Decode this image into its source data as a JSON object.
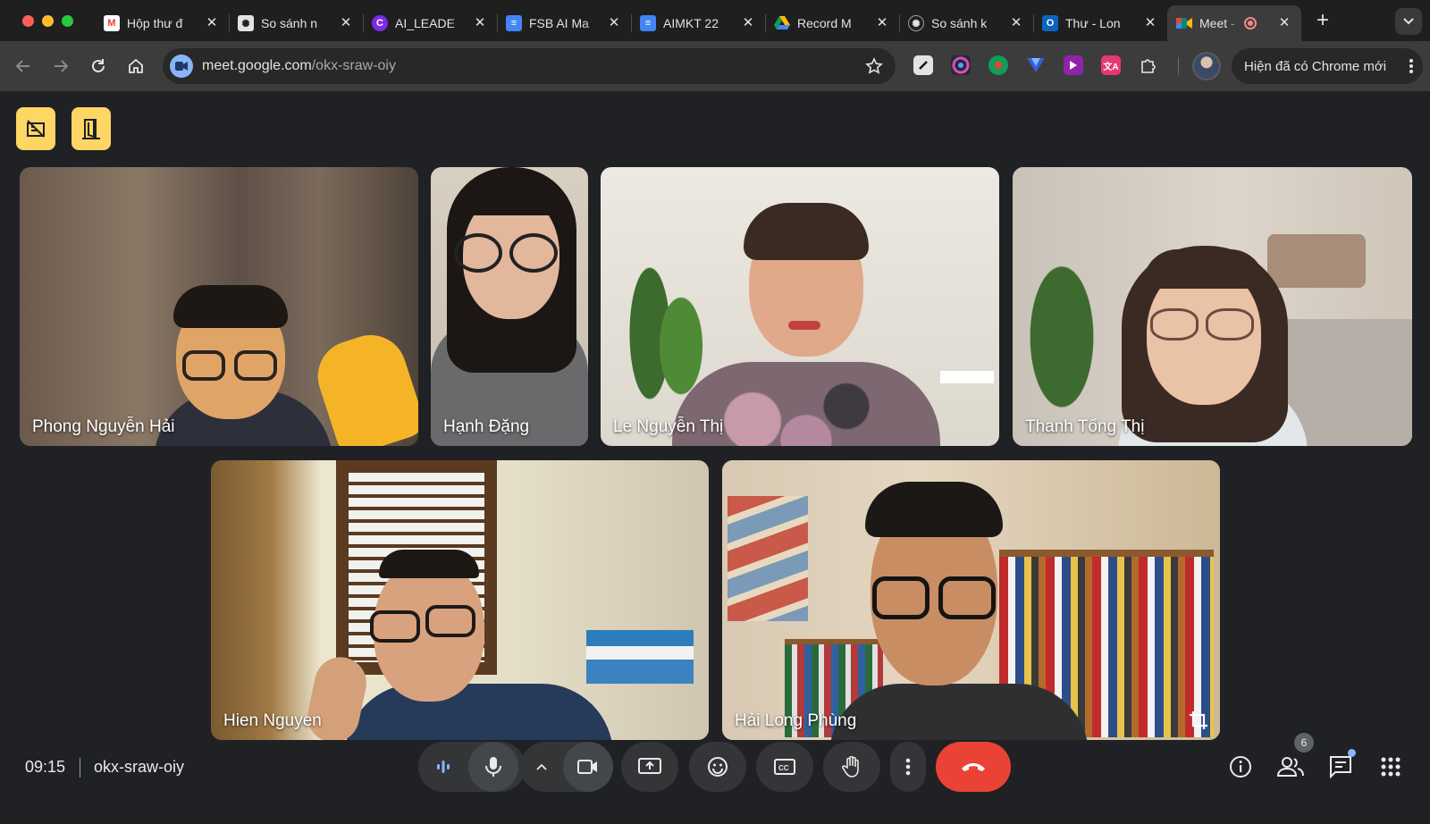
{
  "browser": {
    "tabs": [
      {
        "title": "Hộp thư đ",
        "favicon": "gmail-icon",
        "color": "#ea4335"
      },
      {
        "title": "So sánh n",
        "favicon": "chatgpt-icon",
        "color": "#9e9e9e"
      },
      {
        "title": "AI_LEADE",
        "favicon": "canva-icon",
        "color": "#7d2ae8"
      },
      {
        "title": "FSB AI Ma",
        "favicon": "docs-icon",
        "color": "#4285f4"
      },
      {
        "title": "AIMKT 22",
        "favicon": "docs-icon",
        "color": "#4285f4"
      },
      {
        "title": "Record M",
        "favicon": "drive-icon",
        "color": "#fbbc04"
      },
      {
        "title": "So sánh k",
        "favicon": "chatgpt-icon",
        "color": "#9e9e9e"
      },
      {
        "title": "Thư - Lon",
        "favicon": "outlook-icon",
        "color": "#0a64c2"
      },
      {
        "title": "Meet -",
        "favicon": "meet-icon",
        "color": "#00897b",
        "active": true
      }
    ],
    "url_host": "meet.google.com",
    "url_path": "/okx-sraw-oiy",
    "update_label": "Hiện đã có Chrome mới"
  },
  "meeting": {
    "time": "09:15",
    "code": "okx-sraw-oiy",
    "participant_count": "6",
    "participants": [
      {
        "name": "Phong Nguyễn Hải"
      },
      {
        "name": "Hạnh Đặng"
      },
      {
        "name": "Le Nguyễn Thị"
      },
      {
        "name": "Thanh Tống Thị"
      },
      {
        "name": "Hien Nguyen"
      },
      {
        "name": "Hải Long Phùng",
        "speaking": true
      }
    ]
  },
  "colors": {
    "accent": "#8ab4f8",
    "end_call": "#ea4335",
    "top_buttons": "#fdd663"
  }
}
